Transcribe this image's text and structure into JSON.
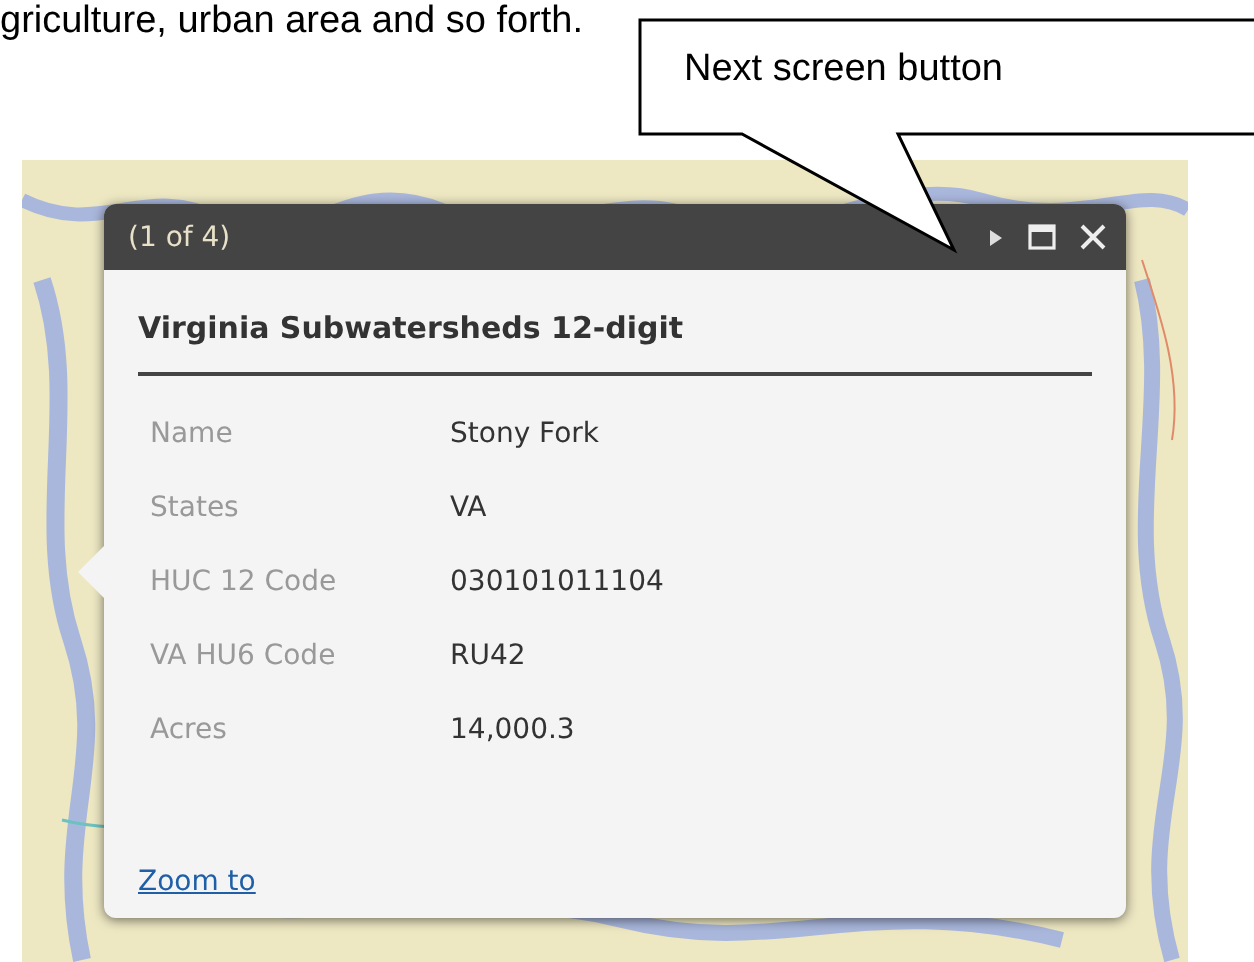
{
  "document_text": "griculture, urban area and so forth.",
  "callout": {
    "text": "Next screen button"
  },
  "popup": {
    "counter": "(1 of 4)",
    "title": "Virginia Subwatersheds 12-digit",
    "fields": [
      {
        "label": "Name",
        "value": "Stony Fork"
      },
      {
        "label": "States",
        "value": "VA"
      },
      {
        "label": "HUC 12 Code",
        "value": "030101011104"
      },
      {
        "label": "VA HU6 Code",
        "value": "RU42"
      },
      {
        "label": "Acres",
        "value": "14,000.3"
      }
    ],
    "link": "Zoom to"
  }
}
